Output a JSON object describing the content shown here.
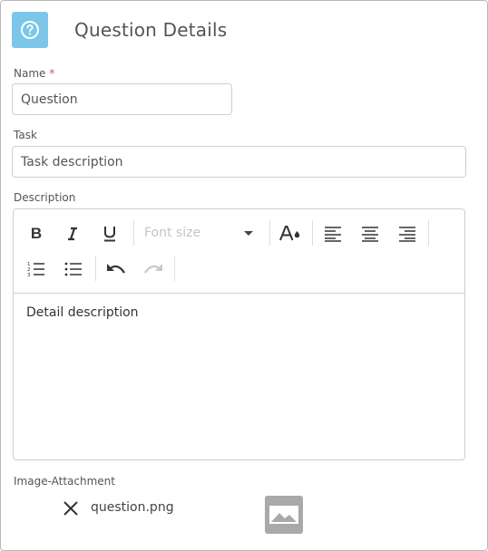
{
  "header": {
    "title": "Question Details",
    "icon": "question-circle-icon",
    "icon_color": "#7cc6ea"
  },
  "name_field": {
    "label": "Name",
    "required_marker": "*",
    "value": "Question"
  },
  "task_field": {
    "label": "Task",
    "value": "Task description"
  },
  "description_field": {
    "label": "Description",
    "toolbar": {
      "bold": "B",
      "font_size_placeholder": "Font size",
      "buttons": [
        "bold-icon",
        "italic-icon",
        "underline-icon",
        "font-color-icon",
        "align-left-icon",
        "align-center-icon",
        "align-right-icon",
        "ordered-list-icon",
        "unordered-list-icon",
        "undo-icon",
        "redo-icon"
      ]
    },
    "content": "Detail description"
  },
  "attachment": {
    "label": "Image-Attachment",
    "filename": "question.png",
    "remove_icon": "close-icon",
    "thumbnail_icon": "image-icon"
  }
}
